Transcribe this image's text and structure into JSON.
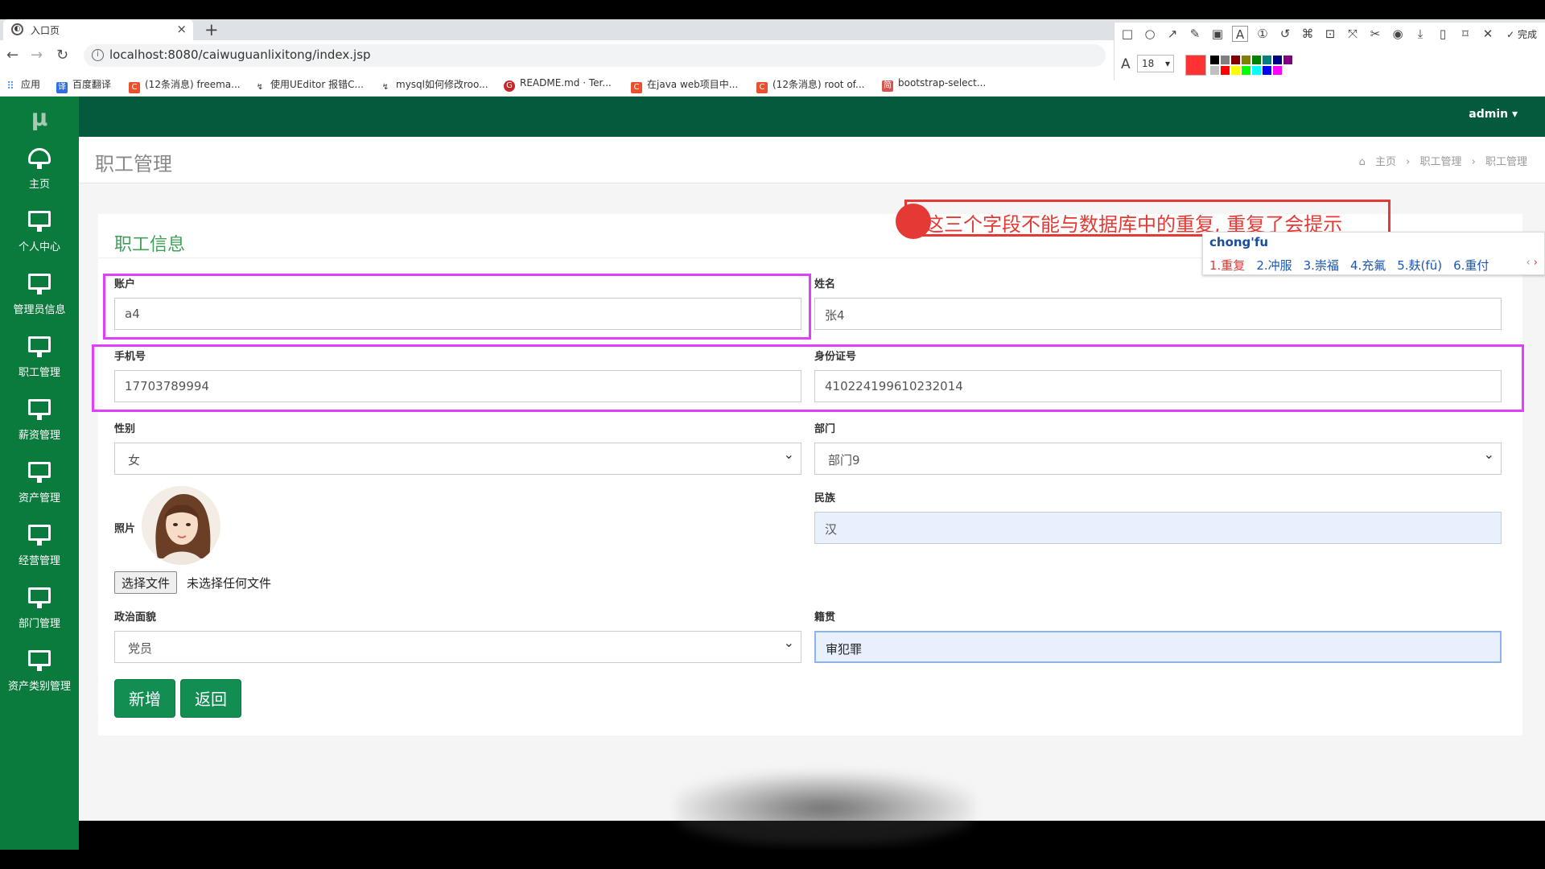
{
  "browser": {
    "tab_title": "入口页",
    "url": "localhost:8080/caiwuguanlixitong/index.jsp",
    "bookmarks": [
      "应用",
      "百度翻译",
      "(12条消息) freema...",
      "使用UEditor 报错C...",
      "mysql如何修改roo...",
      "README.md · Ter...",
      "在java web项目中...",
      "(12条消息) root of...",
      "bootstrap-select..."
    ]
  },
  "shot_tool": {
    "finish_label": "完成",
    "font_size": "18",
    "current_color": "#ff3333",
    "palette": [
      "#000000",
      "#808080",
      "#800000",
      "#808000",
      "#008000",
      "#008080",
      "#000080",
      "#800080",
      "#ffffff",
      "#c0c0c0",
      "#ff0000",
      "#ffff00",
      "#00ff00",
      "#00ffff",
      "#0000ff",
      "#ff00ff"
    ]
  },
  "app": {
    "logo": "μ",
    "user": "admin",
    "sidebar": [
      {
        "label": "主页",
        "icon": "dashboard-icon"
      },
      {
        "label": "个人中心",
        "icon": "monitor-icon"
      },
      {
        "label": "管理员信息",
        "icon": "monitor-icon"
      },
      {
        "label": "职工管理",
        "icon": "monitor-icon"
      },
      {
        "label": "薪资管理",
        "icon": "monitor-icon"
      },
      {
        "label": "资产管理",
        "icon": "monitor-icon"
      },
      {
        "label": "经营管理",
        "icon": "monitor-icon"
      },
      {
        "label": "部门管理",
        "icon": "monitor-icon"
      },
      {
        "label": "资产类别管理",
        "icon": "monitor-icon"
      }
    ],
    "page_title": "职工管理",
    "breadcrumb": [
      "主页",
      "职工管理",
      "职工管理"
    ],
    "accent": "#0b7a3d"
  },
  "form": {
    "title": "职工信息",
    "account": {
      "label": "账户",
      "value": "a4"
    },
    "name": {
      "label": "姓名",
      "value": "张4"
    },
    "phone": {
      "label": "手机号",
      "value": "17703789994"
    },
    "id_number": {
      "label": "身份证号",
      "value": "410224199610232014"
    },
    "gender": {
      "label": "性别",
      "value": "女"
    },
    "department": {
      "label": "部门",
      "value": "部门9"
    },
    "photo": {
      "label": "照片",
      "choose_label": "选择文件",
      "no_file": "未选择任何文件"
    },
    "ethnicity": {
      "label": "民族",
      "value": "汉"
    },
    "politics": {
      "label": "政治面貌",
      "value": "党员"
    },
    "hometown": {
      "label": "籍贯",
      "value": "审犯罪"
    },
    "add_label": "新增",
    "back_label": "返回"
  },
  "annotation": {
    "text": "这三个字段不能与数据库中的重复, 重复了会提示"
  },
  "ime": {
    "input": "chong'fu",
    "candidates": [
      "1.重复",
      "2.冲服",
      "3.崇福",
      "4.充氟",
      "5.麸(fū)",
      "6.重付"
    ]
  }
}
